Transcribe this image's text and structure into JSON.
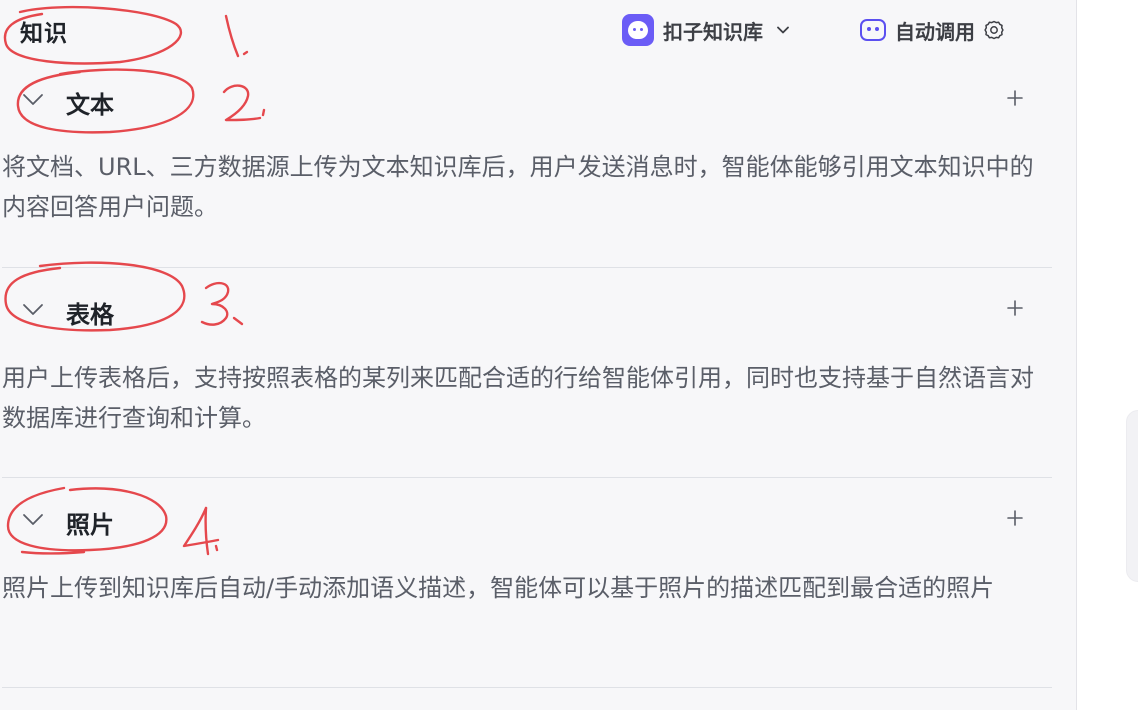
{
  "header": {
    "section_title": "知识",
    "kb_source_label": "扣子知识库",
    "auto_call_label": "自动调用"
  },
  "sections": [
    {
      "label": "文本",
      "description": "将文档、URL、三方数据源上传为文本知识库后，用户发送消息时，智能体能够引用文本知识中的内容回答用户问题。"
    },
    {
      "label": "表格",
      "description": "用户上传表格后，支持按照表格的某列来匹配合适的行给智能体引用，同时也支持基于自然语言对数据库进行查询和计算。"
    },
    {
      "label": "照片",
      "description": "照片上传到知识库后自动/手动添加语义描述，智能体可以基于照片的描述匹配到最合适的照片"
    }
  ],
  "colors": {
    "annotation": "#e5484d",
    "accent": "#5b4ff0"
  },
  "icons": {
    "kb_logo": "coze-mascot-icon",
    "auto_call": "robot-icon",
    "settings": "gear-icon",
    "collapse": "chevron-down-icon",
    "add": "plus-icon"
  }
}
